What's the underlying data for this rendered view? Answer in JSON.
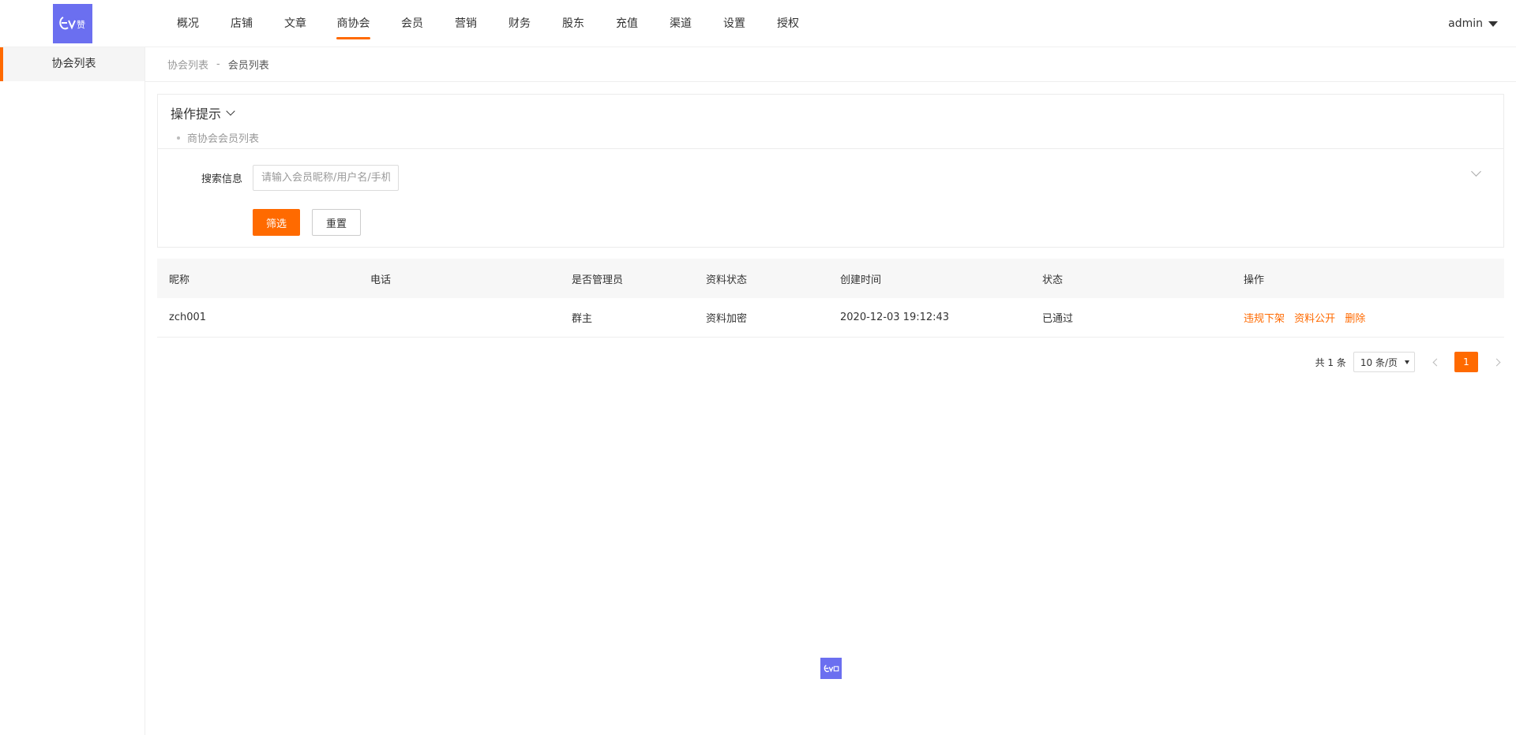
{
  "brand": {
    "logo_text": "ev赞",
    "accent": "#ff6a00",
    "logo_bg": "#6b6ff0"
  },
  "nav": {
    "items": [
      "概况",
      "店铺",
      "文章",
      "商协会",
      "会员",
      "营销",
      "财务",
      "股东",
      "充值",
      "渠道",
      "设置",
      "授权"
    ],
    "active_index": 3
  },
  "user": {
    "name": "admin"
  },
  "sidebar": {
    "items": [
      {
        "label": "协会列表",
        "active": true
      }
    ]
  },
  "breadcrumb": {
    "parent": "协会列表",
    "separator": "-",
    "current": "会员列表"
  },
  "tips": {
    "title": "操作提示",
    "lines": [
      "商协会会员列表"
    ]
  },
  "search": {
    "label": "搜索信息",
    "placeholder": "请输入会员昵称/用户名/手机",
    "value": "",
    "filter_label": "筛选",
    "reset_label": "重置"
  },
  "table": {
    "columns": [
      "昵称",
      "电话",
      "是否管理员",
      "资料状态",
      "创建时间",
      "状态",
      "操作"
    ],
    "rows": [
      {
        "nickname": "zch001",
        "phone": "",
        "is_admin": "群主",
        "profile_status": "资料加密",
        "created": "2020-12-03 19:12:43",
        "status": "已通过",
        "actions": [
          "违规下架",
          "资料公开",
          "删除"
        ]
      }
    ]
  },
  "pagination": {
    "total_text": "共 1 条",
    "page_size": "10 条/页",
    "current_page": "1"
  }
}
